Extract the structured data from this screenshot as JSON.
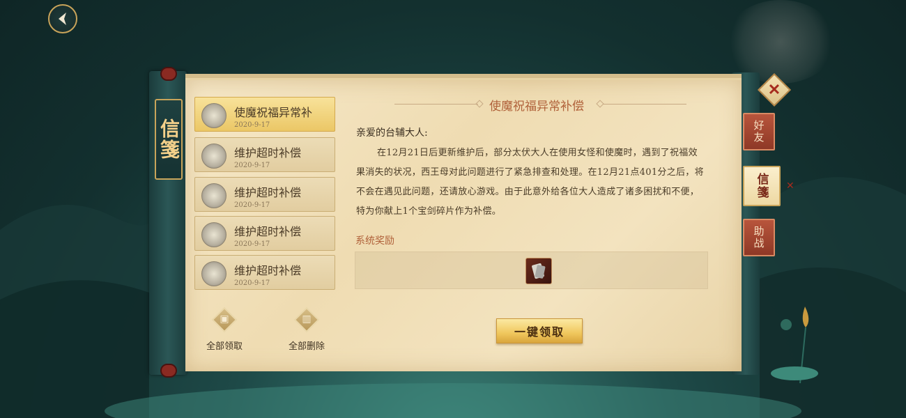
{
  "header": {
    "back_icon": "chevron-left-icon"
  },
  "panel": {
    "title": "信箋"
  },
  "mail_list": [
    {
      "title": "使魔祝福异常补",
      "date": "2020-9-17",
      "active": true
    },
    {
      "title": "维护超时补偿",
      "date": "2020-9-17",
      "active": false
    },
    {
      "title": "维护超时补偿",
      "date": "2020-9-17",
      "active": false
    },
    {
      "title": "维护超时补偿",
      "date": "2020-9-17",
      "active": false
    },
    {
      "title": "维护超时补偿",
      "date": "2020-9-17",
      "active": false
    }
  ],
  "actions": {
    "claim_all": "全部领取",
    "delete_all": "全部删除"
  },
  "detail": {
    "title": "使魔祝福异常补偿",
    "greeting": "亲爱的台辅大人:",
    "body": "在12月21日后更新维护后，部分太伏大人在使用女怪和使魔时，遇到了祝福效果消失的状况，西王母对此问题进行了紧急排查和处理。在12月21点401分之后，将不会在遇见此问题，还请放心游戏。由于此意外给各位大人造成了诸多困扰和不便，特为你献上1个宝剑碎片作为补偿。",
    "reward_label": "系统奖励",
    "claim_button": "一键领取"
  },
  "side_tabs": [
    {
      "label": "好友",
      "active": false
    },
    {
      "label": "信箋",
      "active": true
    },
    {
      "label": "助战",
      "active": false
    }
  ],
  "colors": {
    "accent_gold": "#c9a45a",
    "title_red": "#b0613a",
    "tab_red": "#b8553c",
    "bg_teal": "#1e4a48"
  }
}
